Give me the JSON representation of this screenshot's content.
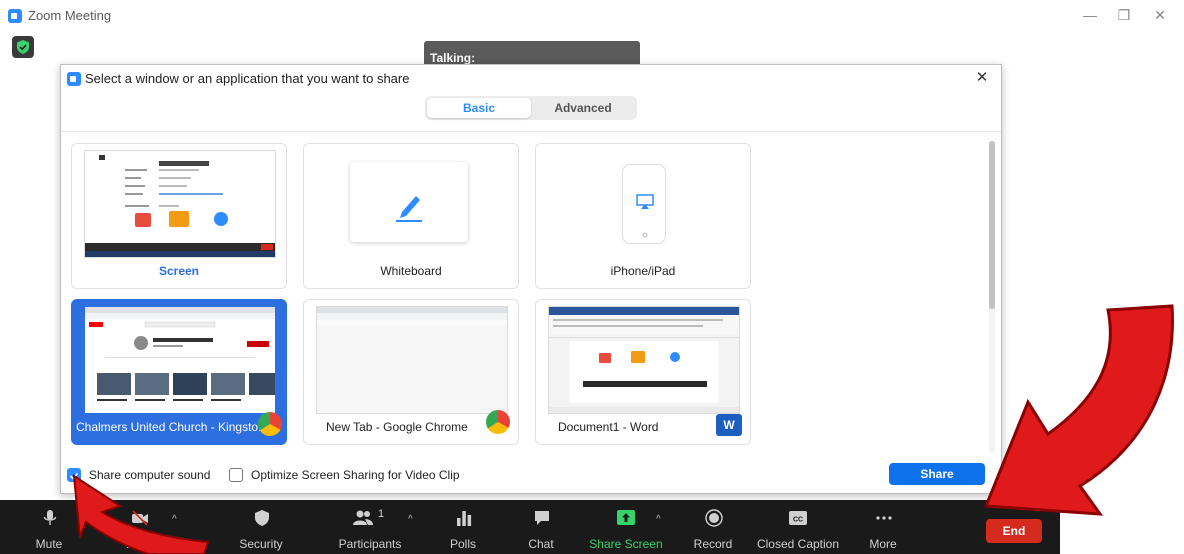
{
  "app": {
    "title": "Zoom Meeting"
  },
  "window_controls": {
    "minimize": "—",
    "maximize": "❐",
    "close": "✕"
  },
  "talking": {
    "label": "Talking:"
  },
  "dialog": {
    "title": "Select a window or an application that you want to share",
    "close": "✕",
    "tabs": [
      {
        "label": "Basic",
        "selected": true
      },
      {
        "label": "Advanced",
        "selected": false
      }
    ],
    "tiles": [
      {
        "label": "Screen",
        "selected": false
      },
      {
        "label": "Whiteboard",
        "selected": false
      },
      {
        "label": "iPhone/iPad",
        "selected": false
      },
      {
        "label": "Chalmers United Church - Kingsto...",
        "selected": true
      },
      {
        "label": "New Tab - Google Chrome",
        "selected": false
      },
      {
        "label": "Document1 - Word",
        "selected": false
      }
    ],
    "options": {
      "share_sound": {
        "label": "Share computer sound",
        "checked": true
      },
      "optimize": {
        "label": "Optimize Screen Sharing for Video Clip",
        "checked": false
      }
    },
    "share_button": "Share"
  },
  "toolbar": {
    "items": [
      {
        "label": "Mute"
      },
      {
        "label": "Video"
      },
      {
        "label": "Security"
      },
      {
        "label": "Participants",
        "count": "1"
      },
      {
        "label": "Polls"
      },
      {
        "label": "Chat"
      },
      {
        "label": "Share Screen"
      },
      {
        "label": "Record"
      },
      {
        "label": "Closed Caption"
      },
      {
        "label": "More"
      }
    ],
    "end": "End"
  },
  "colors": {
    "accent": "#2d8cff",
    "selected": "#2d6fe0",
    "share_green": "#36d36c",
    "end_red": "#d52b1e",
    "toolbar_bg": "#1a1a1a"
  }
}
